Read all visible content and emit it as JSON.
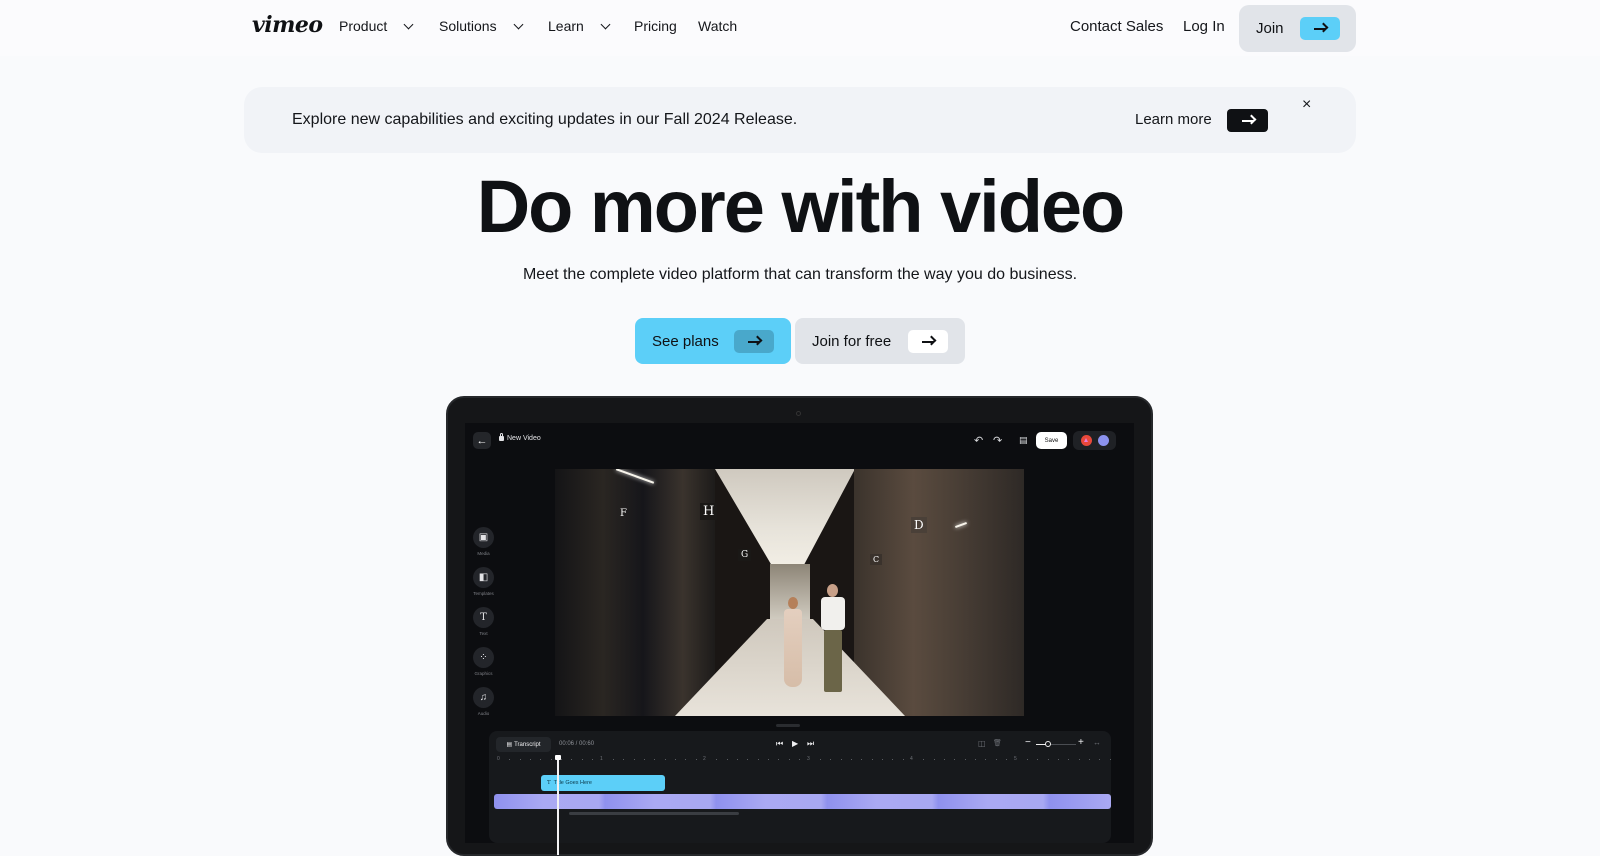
{
  "nav": {
    "logo": "vimeo",
    "items": [
      {
        "label": "Product",
        "dropdown": true
      },
      {
        "label": "Solutions",
        "dropdown": true
      },
      {
        "label": "Learn",
        "dropdown": true
      },
      {
        "label": "Pricing",
        "dropdown": false
      },
      {
        "label": "Watch",
        "dropdown": false
      }
    ],
    "contact_sales": "Contact Sales",
    "log_in": "Log In",
    "join": "Join",
    "accent": "#5ccff8"
  },
  "banner": {
    "text": "Explore new capabilities and exciting updates in our Fall 2024 Release.",
    "learn_more": "Learn more",
    "close": "×"
  },
  "hero": {
    "title": "Do more with video",
    "subtitle": "Meet the complete video platform that can transform the way you do business.",
    "primary_cta": "See plans",
    "secondary_cta": "Join for free"
  },
  "editor": {
    "back_icon": "←",
    "project_title": "New Video",
    "undo_icon": "↶",
    "redo_icon": "↷",
    "comments_icon": "▤",
    "save": "Save",
    "tools": [
      {
        "label": "Media",
        "icon": "▣"
      },
      {
        "label": "Templates",
        "icon": "◧"
      },
      {
        "label": "Text",
        "icon": "T"
      },
      {
        "label": "Graphics",
        "icon": "⁘"
      },
      {
        "label": "Audio",
        "icon": "♫"
      }
    ],
    "video_signs": [
      "H",
      "D",
      "G",
      "C",
      "F"
    ],
    "timeline": {
      "transcript": "Transcript",
      "timecode": "00:06 / 00:60",
      "prev_icon": "⏮",
      "play_icon": "▶",
      "next_icon": "⏭",
      "split_icon": "◫",
      "delete_icon": "🗑",
      "zoom_out": "−",
      "zoom_in": "+",
      "fit_icon": "↔",
      "zoom_level": 0.3,
      "ruler_ticks": [
        "0",
        "1",
        "2",
        "3",
        "4",
        "5"
      ],
      "title_clip": "Title Goes Here",
      "title_clip_icon": "T"
    }
  }
}
